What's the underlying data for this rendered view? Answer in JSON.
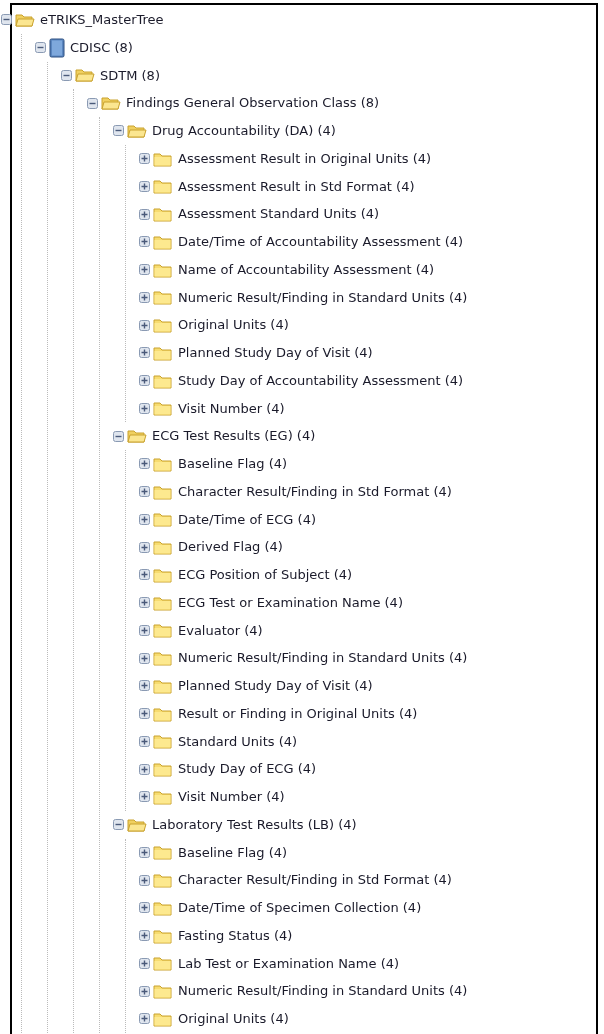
{
  "tree": [
    {
      "label": "eTRIKS_MasterTree",
      "kind": "folder",
      "expanded": true,
      "children": [
        {
          "label": "CDISC (8)",
          "kind": "book",
          "expanded": true,
          "children": [
            {
              "label": "SDTM (8)",
              "kind": "folder",
              "expanded": true,
              "children": [
                {
                  "label": "Findings General Observation Class (8)",
                  "kind": "folder",
                  "expanded": true,
                  "children": [
                    {
                      "label": "Drug Accountability (DA) (4)",
                      "kind": "folder",
                      "expanded": true,
                      "children": [
                        {
                          "label": "Assessment Result in Original Units (4)",
                          "kind": "folder",
                          "expanded": false
                        },
                        {
                          "label": "Assessment Result in Std Format (4)",
                          "kind": "folder",
                          "expanded": false
                        },
                        {
                          "label": "Assessment Standard Units (4)",
                          "kind": "folder",
                          "expanded": false
                        },
                        {
                          "label": "Date/Time of Accountability Assessment (4)",
                          "kind": "folder",
                          "expanded": false
                        },
                        {
                          "label": "Name of Accountability Assessment (4)",
                          "kind": "folder",
                          "expanded": false
                        },
                        {
                          "label": "Numeric Result/Finding in Standard Units (4)",
                          "kind": "folder",
                          "expanded": false
                        },
                        {
                          "label": "Original Units (4)",
                          "kind": "folder",
                          "expanded": false
                        },
                        {
                          "label": "Planned Study Day of Visit (4)",
                          "kind": "folder",
                          "expanded": false
                        },
                        {
                          "label": "Study Day of Accountability Assessment (4)",
                          "kind": "folder",
                          "expanded": false
                        },
                        {
                          "label": "Visit Number (4)",
                          "kind": "folder",
                          "expanded": false
                        }
                      ]
                    },
                    {
                      "label": "ECG Test Results (EG) (4)",
                      "kind": "folder",
                      "expanded": true,
                      "children": [
                        {
                          "label": "Baseline Flag (4)",
                          "kind": "folder",
                          "expanded": false
                        },
                        {
                          "label": "Character Result/Finding in Std Format (4)",
                          "kind": "folder",
                          "expanded": false
                        },
                        {
                          "label": "Date/Time of ECG (4)",
                          "kind": "folder",
                          "expanded": false
                        },
                        {
                          "label": "Derived Flag (4)",
                          "kind": "folder",
                          "expanded": false
                        },
                        {
                          "label": "ECG Position of Subject (4)",
                          "kind": "folder",
                          "expanded": false
                        },
                        {
                          "label": "ECG Test or Examination Name (4)",
                          "kind": "folder",
                          "expanded": false
                        },
                        {
                          "label": "Evaluator (4)",
                          "kind": "folder",
                          "expanded": false
                        },
                        {
                          "label": "Numeric Result/Finding in Standard Units (4)",
                          "kind": "folder",
                          "expanded": false
                        },
                        {
                          "label": "Planned Study Day of Visit (4)",
                          "kind": "folder",
                          "expanded": false
                        },
                        {
                          "label": "Result or Finding in Original Units (4)",
                          "kind": "folder",
                          "expanded": false
                        },
                        {
                          "label": "Standard Units (4)",
                          "kind": "folder",
                          "expanded": false
                        },
                        {
                          "label": "Study Day of ECG (4)",
                          "kind": "folder",
                          "expanded": false
                        },
                        {
                          "label": "Visit Number (4)",
                          "kind": "folder",
                          "expanded": false
                        }
                      ]
                    },
                    {
                      "label": "Laboratory Test Results (LB) (4)",
                      "kind": "folder",
                      "expanded": true,
                      "children": [
                        {
                          "label": "Baseline Flag (4)",
                          "kind": "folder",
                          "expanded": false
                        },
                        {
                          "label": "Character Result/Finding in Std Format (4)",
                          "kind": "folder",
                          "expanded": false
                        },
                        {
                          "label": "Date/Time of Specimen Collection (4)",
                          "kind": "folder",
                          "expanded": false
                        },
                        {
                          "label": "Fasting Status (4)",
                          "kind": "folder",
                          "expanded": false
                        },
                        {
                          "label": "Lab Test or Examination Name (4)",
                          "kind": "folder",
                          "expanded": false
                        },
                        {
                          "label": "Numeric Result/Finding in Standard Units (4)",
                          "kind": "folder",
                          "expanded": false
                        },
                        {
                          "label": "Original Units (4)",
                          "kind": "folder",
                          "expanded": false
                        }
                      ]
                    }
                  ]
                }
              ]
            }
          ]
        }
      ]
    }
  ]
}
